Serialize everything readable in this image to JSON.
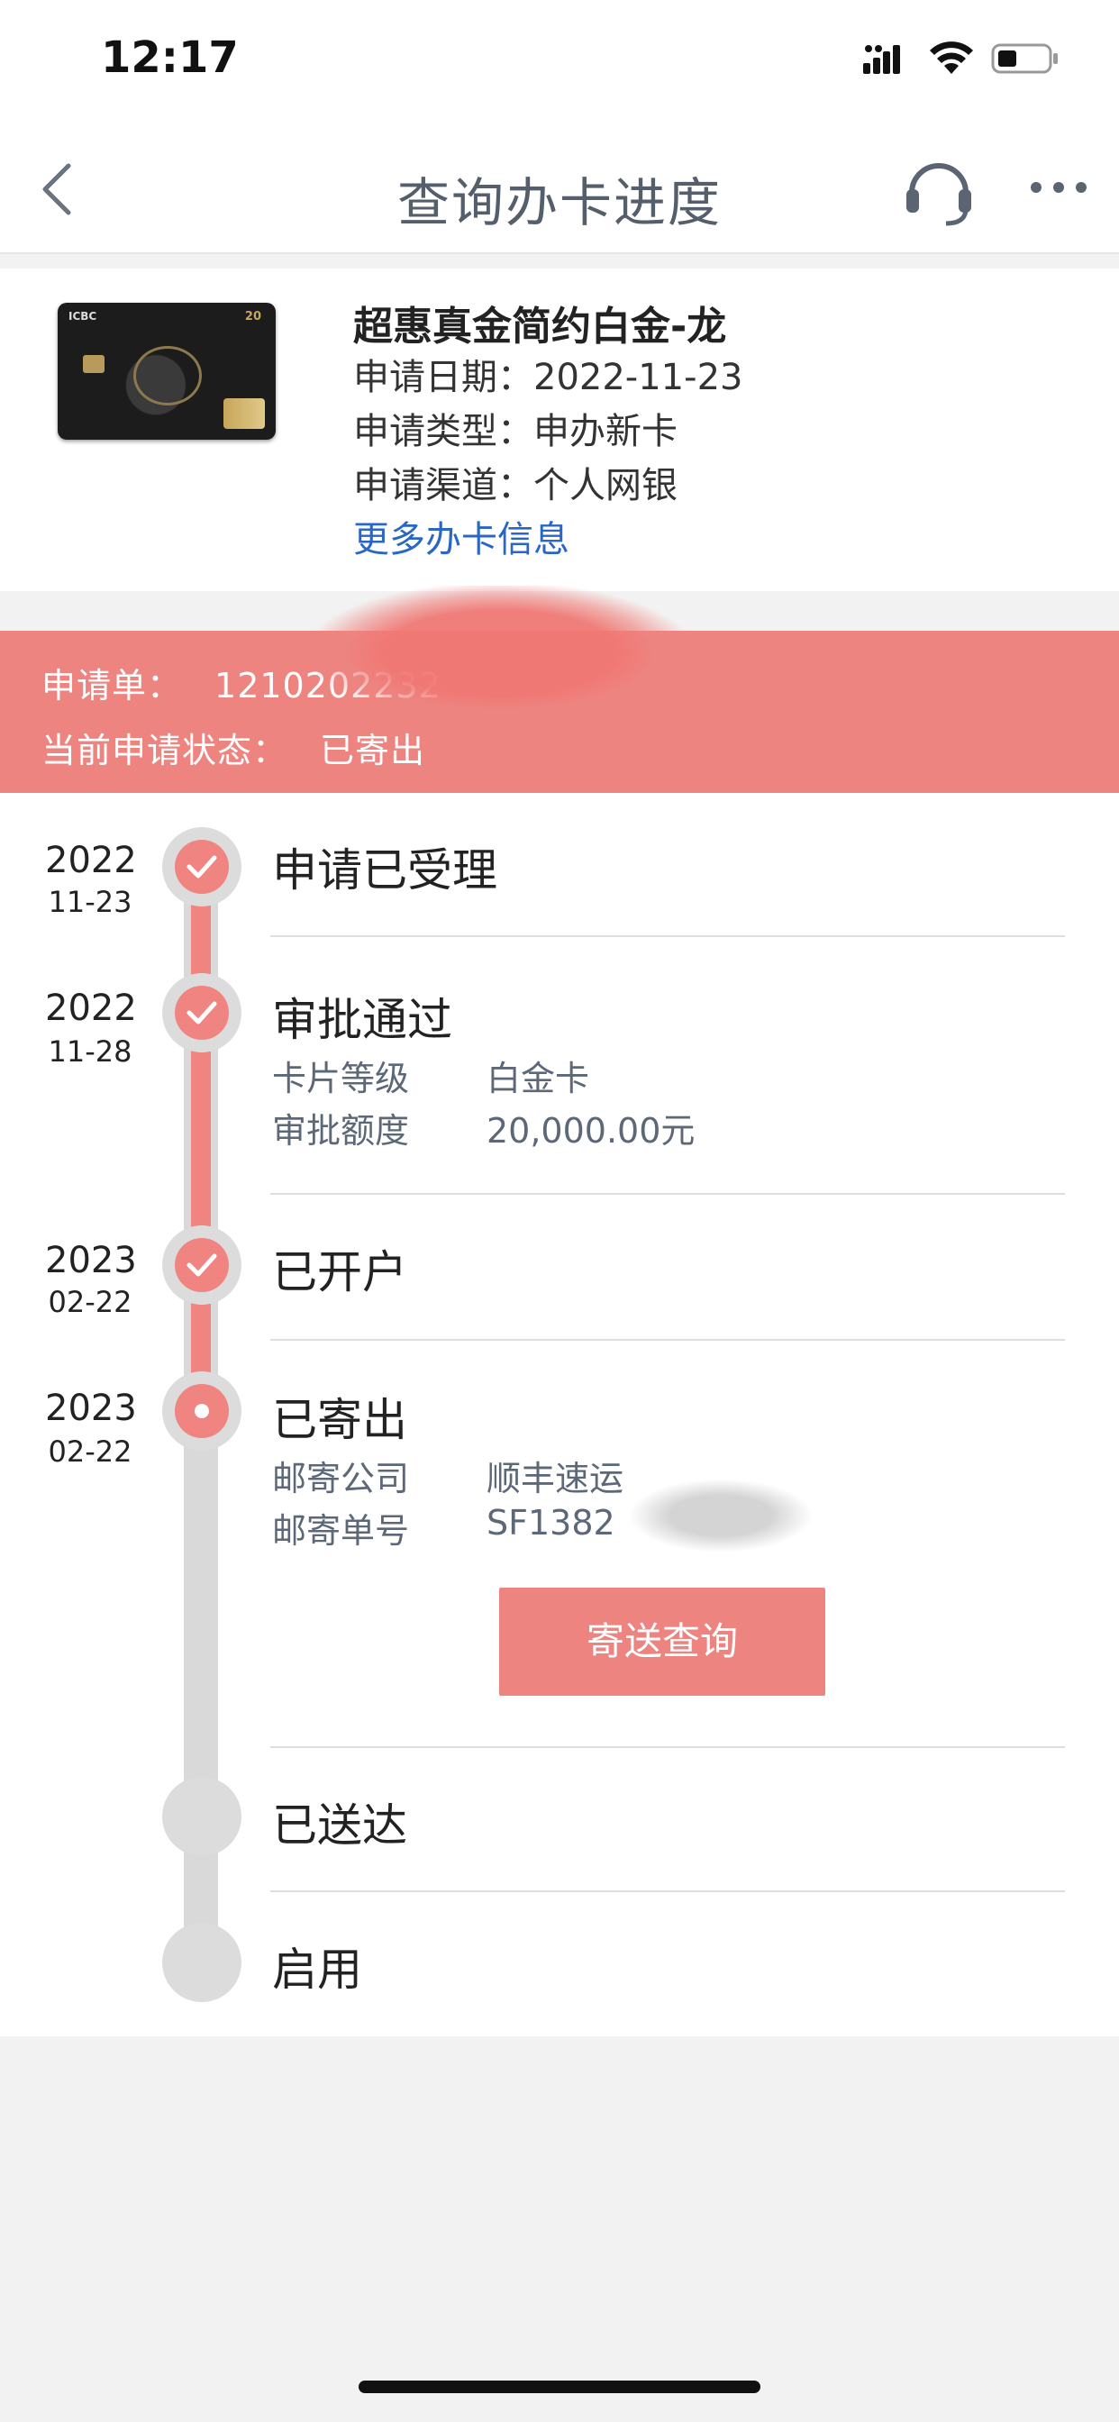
{
  "status_bar": {
    "time": "12:17"
  },
  "nav": {
    "title": "查询办卡进度"
  },
  "card": {
    "name": "超惠真金简约白金-龙",
    "apply_date_label": "申请日期：",
    "apply_date": "2022-11-23",
    "apply_type_label": "申请类型：",
    "apply_type": "申办新卡",
    "apply_channel_label": "申请渠道：",
    "apply_channel": "个人网银",
    "more_link": "更多办卡信息",
    "card_brand": "ICBC",
    "card_badge": "20"
  },
  "application": {
    "number_label": "申请单：",
    "number": "1210202232",
    "status_label": "当前申请状态：",
    "status": "已寄出"
  },
  "timeline": [
    {
      "year": "2022",
      "date": "11-23",
      "title": "申请已受理",
      "state": "done"
    },
    {
      "year": "2022",
      "date": "11-28",
      "title": "审批通过",
      "state": "done",
      "details": [
        {
          "key": "卡片等级",
          "value": "白金卡"
        },
        {
          "key": "审批额度",
          "value": "20,000.00元"
        }
      ]
    },
    {
      "year": "2023",
      "date": "02-22",
      "title": "已开户",
      "state": "done"
    },
    {
      "year": "2023",
      "date": "02-22",
      "title": "已寄出",
      "state": "current",
      "details": [
        {
          "key": "邮寄公司",
          "value": "顺丰速运"
        },
        {
          "key": "邮寄单号",
          "value": "SF1382"
        }
      ],
      "button": "寄送查询"
    },
    {
      "title": "已送达",
      "state": "pending"
    },
    {
      "title": "启用",
      "state": "pending"
    }
  ],
  "colors": {
    "accent": "#ee8480",
    "link": "#2a67c4",
    "pending": "#d9d9d9"
  }
}
